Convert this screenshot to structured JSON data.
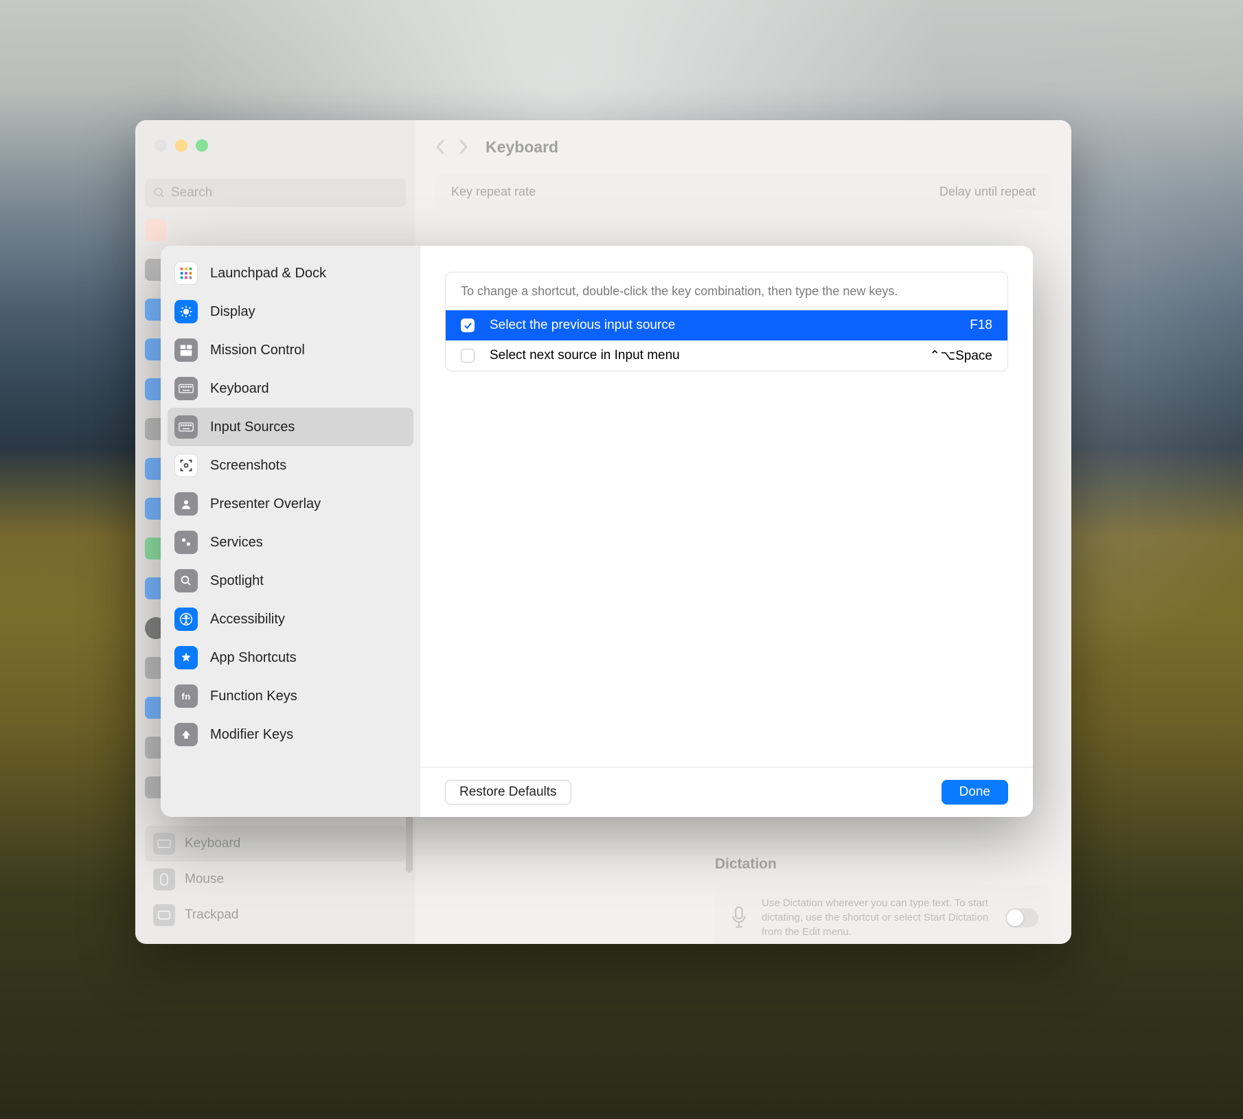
{
  "parent_window": {
    "title": "Keyboard",
    "search_placeholder": "Search",
    "card": {
      "repeat": "Key repeat rate",
      "delay": "Delay until repeat"
    },
    "side_items": [
      {
        "label": "Keyboard",
        "selected": true
      },
      {
        "label": "Mouse",
        "selected": false
      },
      {
        "label": "Trackpad",
        "selected": false
      }
    ],
    "dictation": {
      "title": "Dictation",
      "text": "Use Dictation wherever you can type text. To start dictating, use the shortcut or select Start Dictation from the Edit menu."
    }
  },
  "sheet": {
    "categories": [
      {
        "id": "launchpad",
        "label": "Launchpad & Dock",
        "icon_style": "ci-white"
      },
      {
        "id": "display",
        "label": "Display",
        "icon_style": "ci-blue"
      },
      {
        "id": "mission",
        "label": "Mission Control",
        "icon_style": "ci-gray"
      },
      {
        "id": "keyboard",
        "label": "Keyboard",
        "icon_style": "ci-gray"
      },
      {
        "id": "input",
        "label": "Input Sources",
        "icon_style": "ci-gray",
        "selected": true
      },
      {
        "id": "screenshots",
        "label": "Screenshots",
        "icon_style": "ci-white"
      },
      {
        "id": "presenter",
        "label": "Presenter Overlay",
        "icon_style": "ci-gray"
      },
      {
        "id": "services",
        "label": "Services",
        "icon_style": "ci-gray"
      },
      {
        "id": "spotlight",
        "label": "Spotlight",
        "icon_style": "ci-gray"
      },
      {
        "id": "accessibility",
        "label": "Accessibility",
        "icon_style": "ci-blue"
      },
      {
        "id": "appshortcuts",
        "label": "App Shortcuts",
        "icon_style": "ci-blue"
      },
      {
        "id": "function",
        "label": "Function Keys",
        "icon_style": "ci-fn"
      },
      {
        "id": "modifier",
        "label": "Modifier Keys",
        "icon_style": "ci-gray"
      }
    ],
    "instructions": "To change a shortcut, double-click the key combination, then type the new keys.",
    "shortcuts": [
      {
        "label": "Select the previous input source",
        "key": "F18",
        "enabled": true,
        "selected": true
      },
      {
        "label": "Select next source in Input menu",
        "key": "⌃⌥Space",
        "enabled": false,
        "selected": false
      }
    ],
    "restore": "Restore Defaults",
    "done": "Done"
  }
}
